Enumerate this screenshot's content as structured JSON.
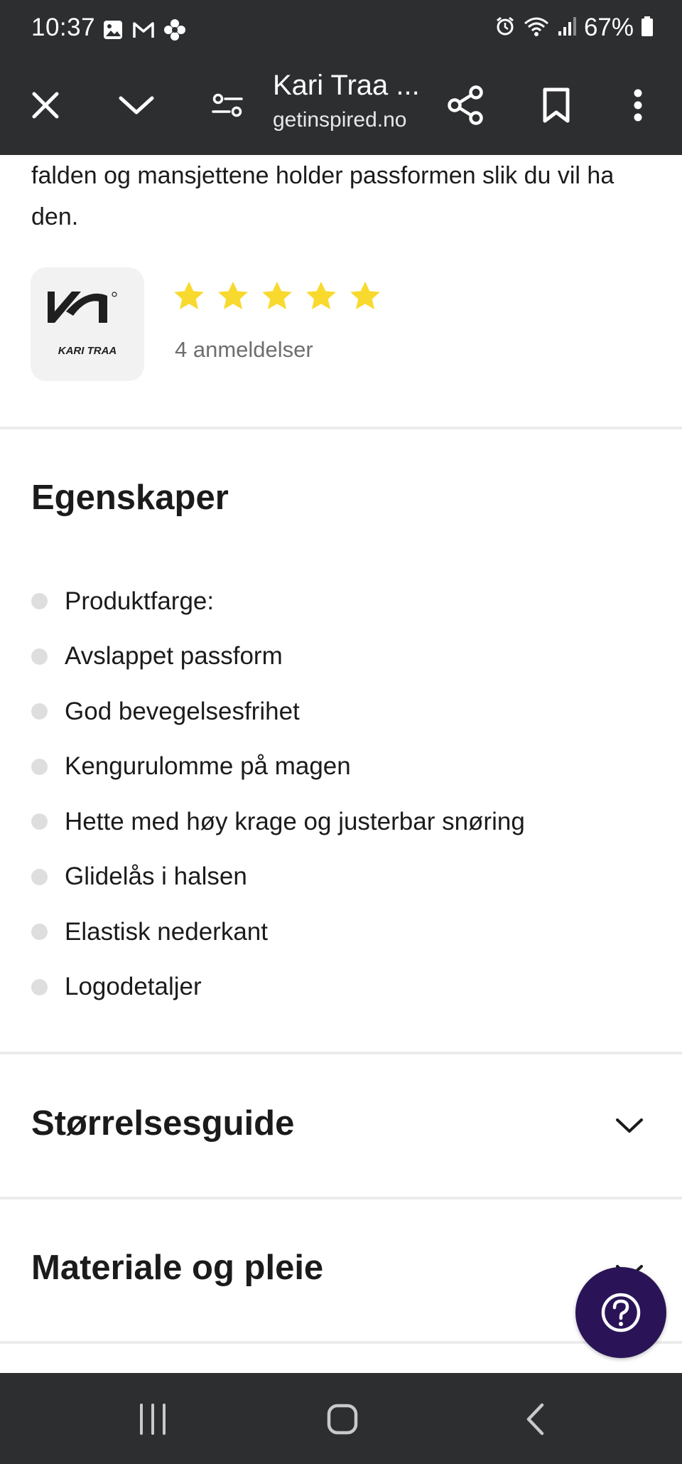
{
  "status_bar": {
    "time": "10:37",
    "battery": "67%",
    "left_icons": [
      "gallery-icon",
      "gmail-icon",
      "flower-icon"
    ],
    "right_icons": [
      "alarm-icon",
      "wifi-icon",
      "signal-icon",
      "battery-icon"
    ]
  },
  "toolbar": {
    "title": "Kari Traa ...",
    "domain": "getinspired.no",
    "icons": [
      "close-icon",
      "chevron-down-icon",
      "page-settings-icon",
      "share-icon",
      "bookmark-icon",
      "more-vert-icon"
    ]
  },
  "product": {
    "description_tail": "falden og mansjettene holder passformen slik du vil ha den.",
    "brand_logo_text": "KARI TRAA",
    "rating_stars": 5,
    "review_count": "4 anmeldelser",
    "star_color": "#f8d92e"
  },
  "features": {
    "heading": "Egenskaper",
    "items": [
      "Produktfarge:",
      "Avslappet passform",
      "God bevegelsesfrihet",
      "Kengurulomme på magen",
      "Hette med høy krage og justerbar snøring",
      "Glidelås i halsen",
      "Elastisk nederkant",
      "Logodetaljer"
    ]
  },
  "accordion": {
    "size_guide": "Størrelsesguide",
    "material_care": "Materiale og pleie"
  },
  "help_button": {
    "icon": "help-icon",
    "color": "#2a1457"
  },
  "nav_bar": {
    "icons": [
      "recent-apps-icon",
      "home-icon",
      "back-icon"
    ]
  }
}
